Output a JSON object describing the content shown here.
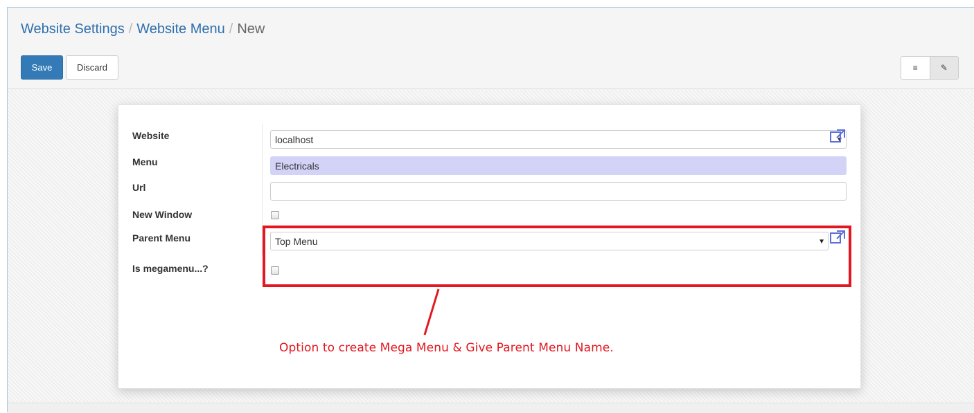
{
  "breadcrumb": {
    "items": [
      "Website Settings",
      "Website Menu"
    ],
    "separator": "/",
    "current": "New"
  },
  "toolbar": {
    "save_label": "Save",
    "discard_label": "Discard"
  },
  "view_switcher": {
    "list_icon": "list-icon",
    "form_icon": "edit-icon",
    "list_glyph": "≡",
    "form_glyph": "✎"
  },
  "form": {
    "website": {
      "label": "Website",
      "value": "localhost"
    },
    "menu": {
      "label": "Menu",
      "value": "Electricals"
    },
    "url": {
      "label": "Url",
      "value": ""
    },
    "new_window": {
      "label": "New Window",
      "checked": false
    },
    "parent_menu": {
      "label": "Parent Menu",
      "value": "Top Menu"
    },
    "is_megamenu": {
      "label": "Is megamenu...?",
      "checked": false
    }
  },
  "annotation": {
    "text": "Option to create Mega Menu & Give Parent Menu Name.",
    "color": "#e3171f"
  },
  "colors": {
    "primary": "#337ab7",
    "link": "#2f6fad",
    "required_field": "#d3d3f8",
    "external_link_icon": "#5b6fd6"
  }
}
